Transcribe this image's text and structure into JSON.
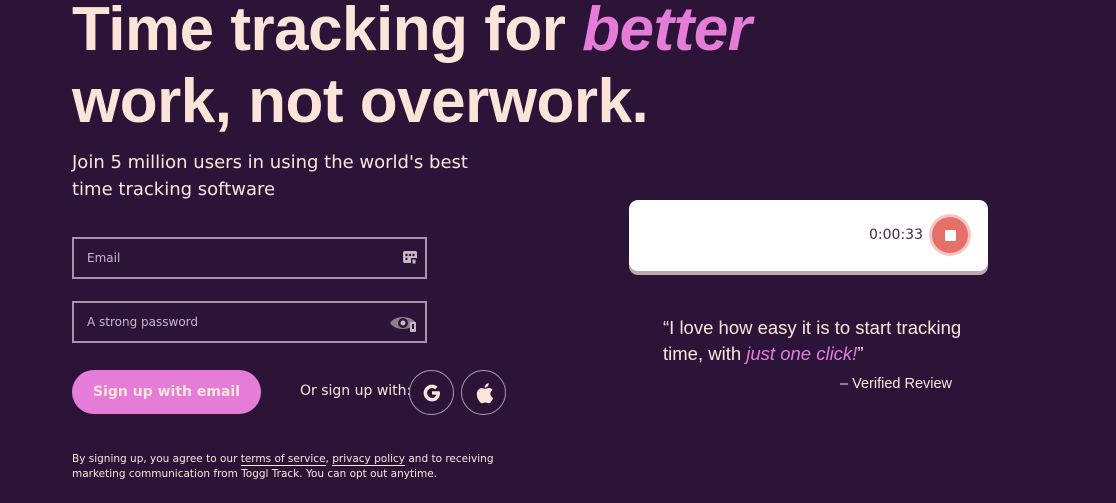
{
  "hero": {
    "headline_prefix": "Time tracking for ",
    "headline_accent": "better",
    "headline_line2": "work, not overwork.",
    "subhead": "Join 5 million users in using the world's best time tracking software"
  },
  "form": {
    "email_placeholder": "Email",
    "email_value": "",
    "password_placeholder": "A strong password",
    "password_value": "",
    "signup_button": "Sign up with email",
    "or_label": "Or sign up with:",
    "social": [
      "google-icon",
      "apple-icon"
    ]
  },
  "legal": {
    "text_1": "By signing up, you agree to our ",
    "terms_link": "terms of service",
    "text_2": ", ",
    "privacy_link": "privacy policy",
    "text_3": " and to receiving marketing communication from Toggl Track. You can opt out anytime."
  },
  "timer": {
    "value": "0:00:33",
    "stop_icon": "stop-icon"
  },
  "testimonial": {
    "open_quote": "“",
    "text": "I love how easy it is to start tracking time, with ",
    "accent": "just one click!",
    "close_quote": "”",
    "source": "– Verified Review"
  },
  "colors": {
    "background": "#2c1338",
    "text": "#fce5d8",
    "accent": "#e57cd8",
    "stop": "#e57068",
    "border": "#a495a9"
  }
}
